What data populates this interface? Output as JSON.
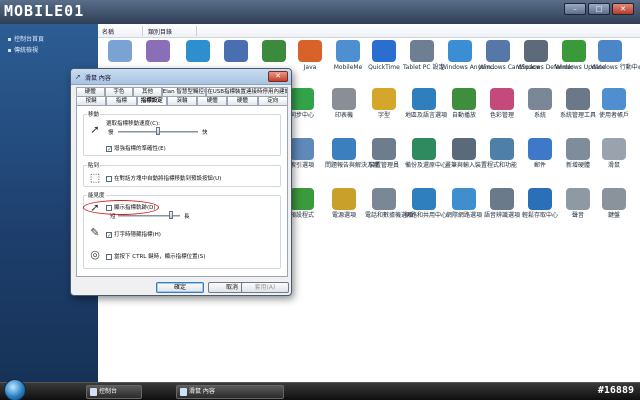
{
  "brand": {
    "logo_text": "MOBILE01",
    "watermark": "#16889"
  },
  "left_pane": {
    "links": [
      "控制台首頁",
      "傳統檢視"
    ]
  },
  "columns": [
    "名稱",
    "類別目錄"
  ],
  "control_panel_items": [
    {
      "label": "",
      "color": "#7aa3d4",
      "icon": "tools-icon"
    },
    {
      "label": "",
      "color": "#8a6fb8",
      "icon": "game-icon"
    },
    {
      "label": "",
      "color": "#2e8fcf",
      "icon": "wifi-icon"
    },
    {
      "label": "",
      "color": "#4a6fb0",
      "icon": "display-icon"
    },
    {
      "label": "",
      "color": "#3c8a3c",
      "icon": "globe-icon"
    },
    {
      "label": "Java",
      "color": "#d9612a",
      "icon": "java-icon"
    },
    {
      "label": "MobileMe",
      "color": "#4d8fd1",
      "icon": "mobileme-icon"
    },
    {
      "label": "QuickTime",
      "color": "#2a6fcf",
      "icon": "quicktime-icon"
    },
    {
      "label": "Tablet PC 設定",
      "color": "#6f7f93",
      "icon": "tablet-icon"
    },
    {
      "label": "Windows Anytim...",
      "color": "#3b8ed3",
      "icon": "windows-icon"
    },
    {
      "label": "Windows CardSpace",
      "color": "#5678a8",
      "icon": "cardspace-icon"
    },
    {
      "label": "Windows Defender",
      "color": "#5c6a7a",
      "icon": "defender-icon"
    },
    {
      "label": "Windows Update",
      "color": "#3a9a3a",
      "icon": "update-icon"
    },
    {
      "label": "Windows 行動中心",
      "color": "#4a86c8",
      "icon": "mobility-icon"
    },
    {
      "label": "同步中心",
      "color": "#33a34a",
      "icon": "sync-icon"
    },
    {
      "label": "印表機",
      "color": "#8a8f96",
      "icon": "printer-icon"
    },
    {
      "label": "字型",
      "color": "#d4a72a",
      "icon": "font-icon"
    },
    {
      "label": "地區及語言選項",
      "color": "#2f7fbf",
      "icon": "region-icon"
    },
    {
      "label": "自動播放",
      "color": "#3e8e3e",
      "icon": "autoplay-icon"
    },
    {
      "label": "色彩管理",
      "color": "#c34a7a",
      "icon": "color-icon"
    },
    {
      "label": "系統",
      "color": "#7a8796",
      "icon": "system-icon"
    },
    {
      "label": "系統管理工具",
      "color": "#6a7888",
      "icon": "admin-icon"
    },
    {
      "label": "使用者帳戶",
      "color": "#4f8fcf",
      "icon": "users-icon"
    },
    {
      "label": "索引選項",
      "color": "#5f89b9",
      "icon": "index-icon"
    },
    {
      "label": "問題報告與解決方案",
      "color": "#3b7fbf",
      "icon": "problem-icon"
    },
    {
      "label": "裝置管理員",
      "color": "#6e7d8e",
      "icon": "device-icon"
    },
    {
      "label": "備份及還原中心",
      "color": "#2f8a5f",
      "icon": "backup-icon"
    },
    {
      "label": "畫筆與輸入裝置",
      "color": "#5a6a7a",
      "icon": "pen-icon"
    },
    {
      "label": "程式和功能",
      "color": "#4e7fa8",
      "icon": "programs-icon"
    },
    {
      "label": "郵件",
      "color": "#3e78c8",
      "icon": "mail-icon"
    },
    {
      "label": "新增硬體",
      "color": "#7f8c9a",
      "icon": "hardware-icon"
    },
    {
      "label": "滑鼠",
      "color": "#9aa3ad",
      "icon": "mouse-icon"
    },
    {
      "label": "預設程式",
      "color": "#3b9a3b",
      "icon": "default-icon"
    },
    {
      "label": "電源選項",
      "color": "#c8a02a",
      "icon": "power-icon"
    },
    {
      "label": "電話和數據機選項",
      "color": "#7a8896",
      "icon": "phone-icon"
    },
    {
      "label": "網路和共用中心",
      "color": "#2f7fbf",
      "icon": "network-icon"
    },
    {
      "label": "網際網路選項",
      "color": "#3f8fcf",
      "icon": "ie-icon"
    },
    {
      "label": "語音辨識選項",
      "color": "#6a7a8a",
      "icon": "speech-icon"
    },
    {
      "label": "輕鬆存取中心",
      "color": "#2a6fb8",
      "icon": "ease-icon"
    },
    {
      "label": "聲音",
      "color": "#8f99a3",
      "icon": "sound-icon"
    },
    {
      "label": "鍵盤",
      "color": "#8a939c",
      "icon": "keyboard-icon"
    }
  ],
  "dialog": {
    "title": "滑鼠 內容",
    "tabs_row1": [
      "硬體",
      "字色",
      "其他",
      "Elan 智慧型觸控板",
      "在USB指標裝置連接時停用內建的指標裝置"
    ],
    "tabs_row2": [
      "按鍵",
      "指標",
      "指標設定",
      "滾輪",
      "硬體",
      "硬體",
      "定向"
    ],
    "groups": {
      "motion": {
        "title": "移動",
        "speed_label": "選取指標移動速度(C):",
        "slow": "慢",
        "fast": "快",
        "precision": "增強指標的準確性(E)",
        "speed_value": 0.5
      },
      "snap": {
        "title": "貼到",
        "text": "在對話方塊中自動將指標移動到預設按鈕(U)"
      },
      "visibility": {
        "title": "能見度",
        "trails": "顯示指標軌跡(D)",
        "short": "短",
        "long": "長",
        "trail_value": 0.85,
        "hide_typing": "打字時隱藏指標(H)",
        "ctrl_locate": "當按下 CTRL 鍵時，顯示指標位置(S)"
      }
    },
    "buttons": {
      "ok": "確定",
      "cancel": "取消",
      "apply": "套用(A)"
    }
  },
  "taskbar": {
    "items": [
      "控制台",
      "滑鼠 內容"
    ]
  }
}
